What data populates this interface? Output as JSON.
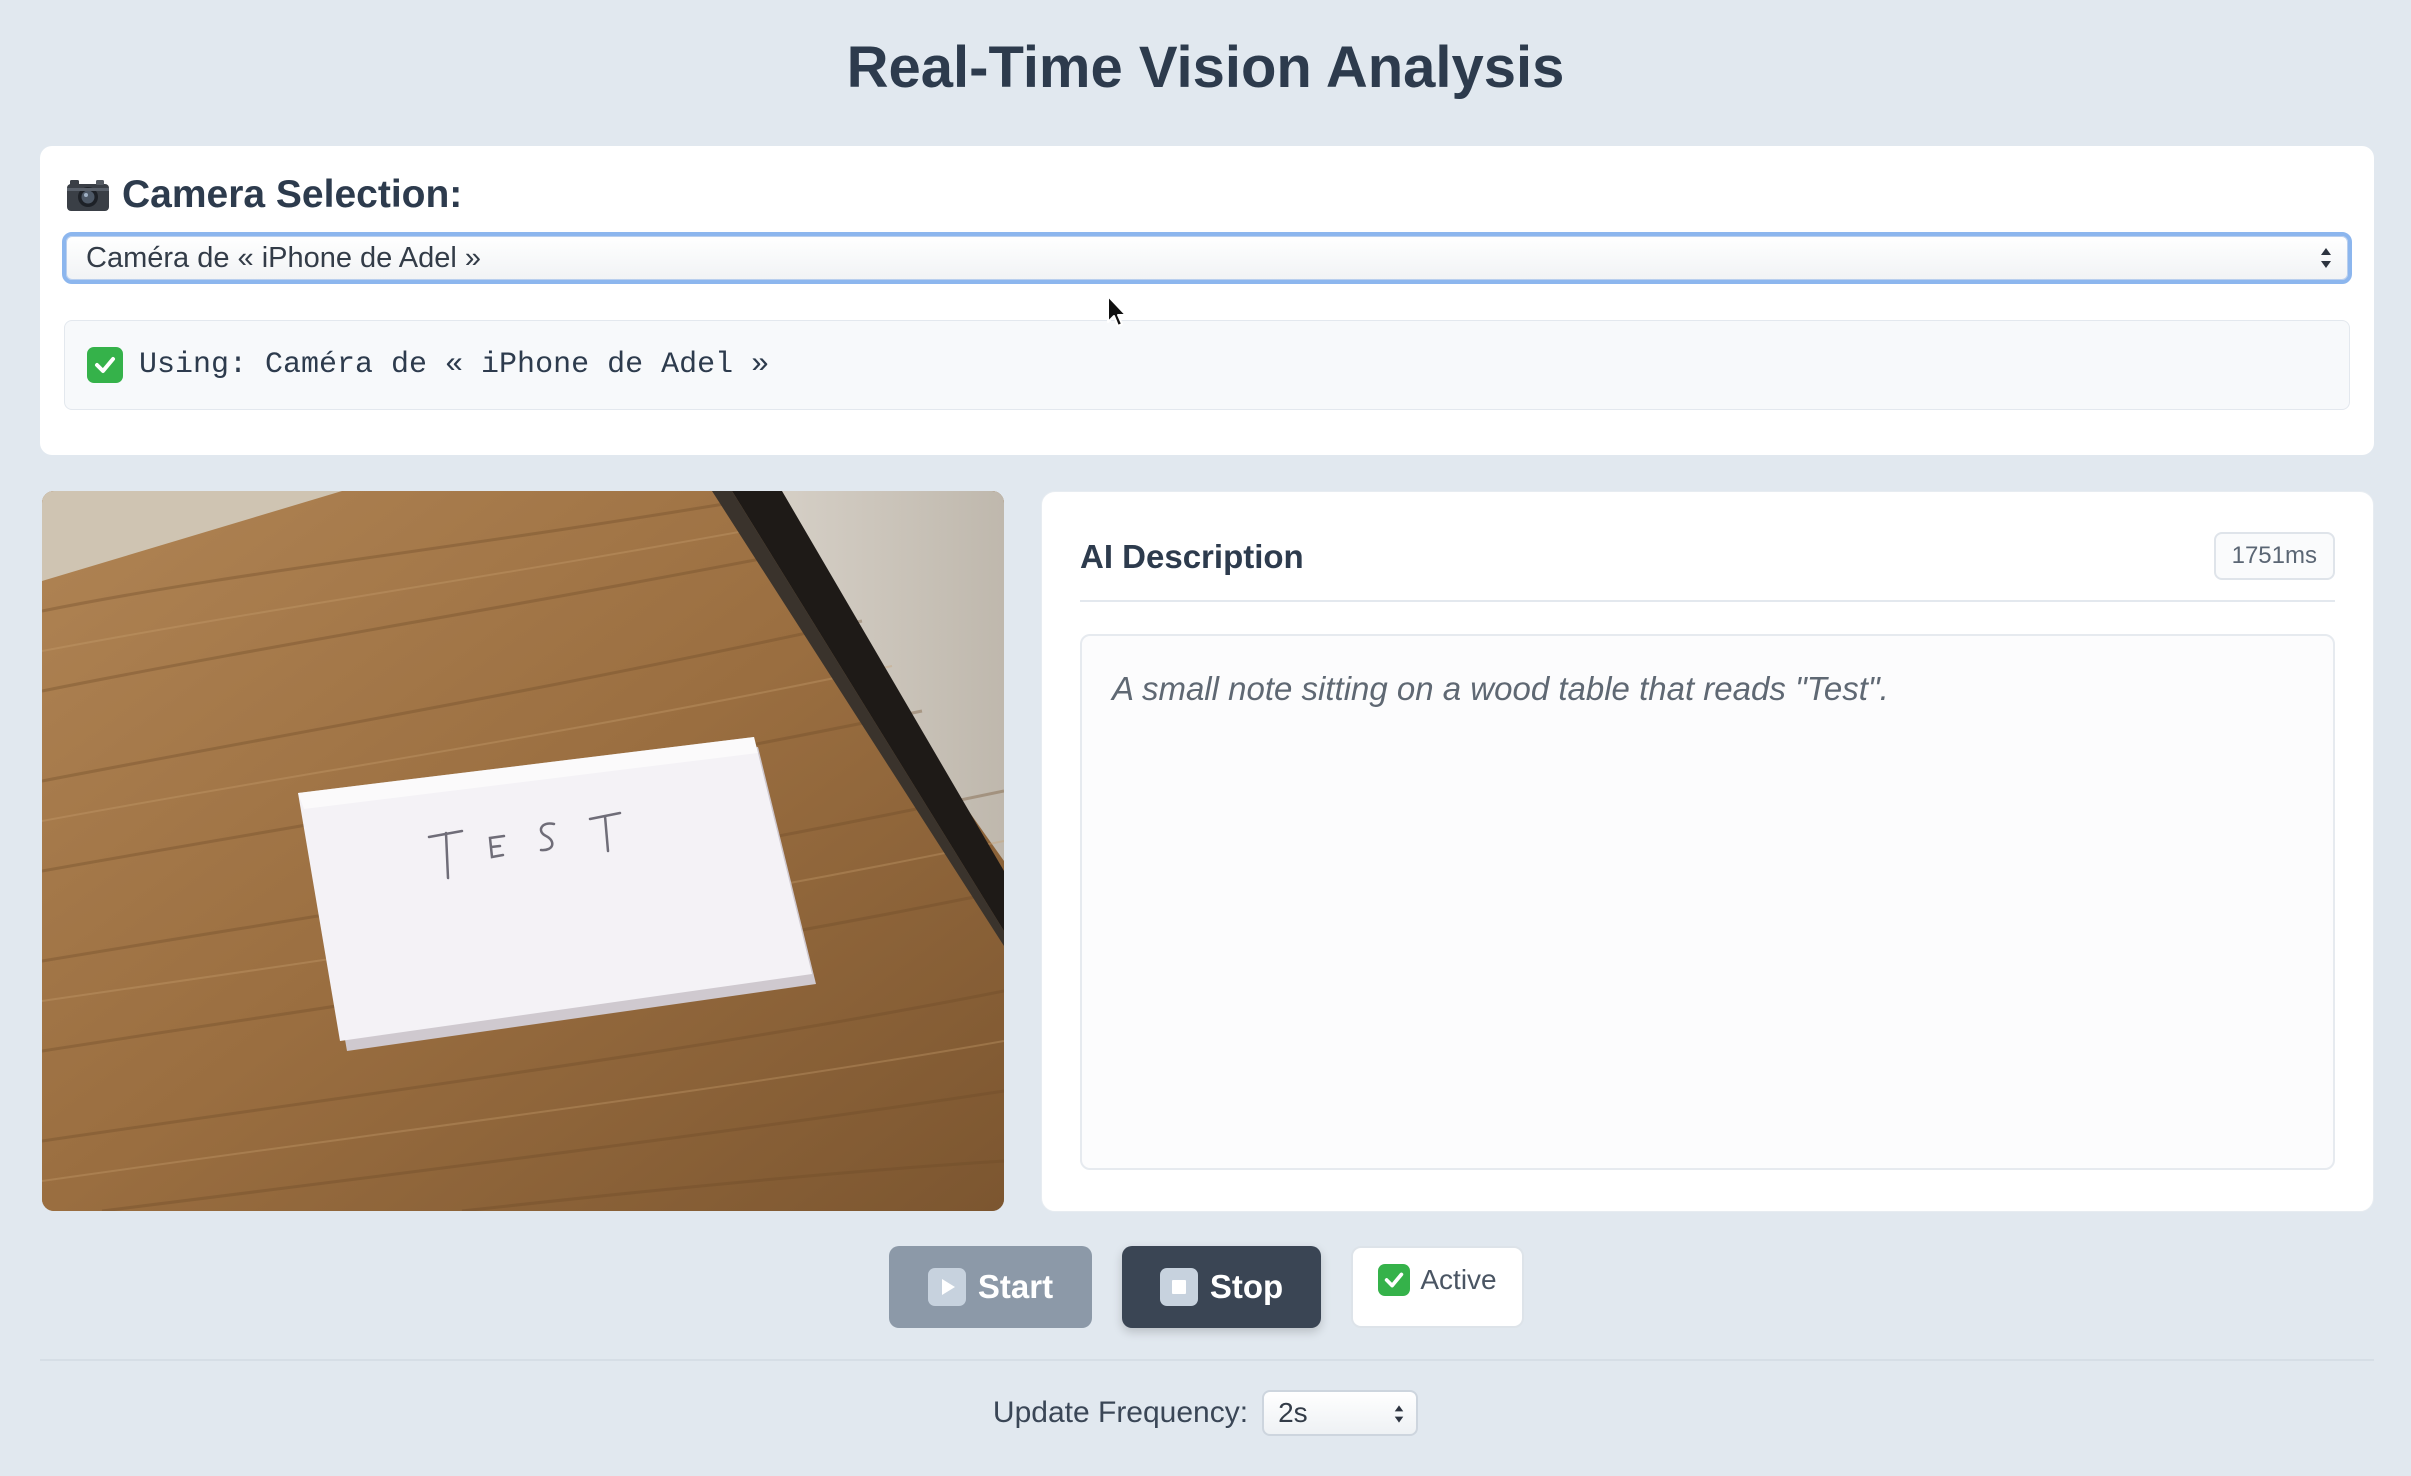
{
  "page": {
    "title": "Real-Time Vision Analysis"
  },
  "camera": {
    "heading_icon": "camera-icon",
    "heading": "Camera Selection:",
    "selected_option": "Caméra de « iPhone de Adel »",
    "status_icon": "check-icon",
    "status_text": "Using: Caméra de « iPhone de Adel »"
  },
  "video": {
    "note_text": "TEST"
  },
  "description": {
    "title": "AI Description",
    "latency": "1751ms",
    "text": "A small note sitting on a wood table that reads \"Test\"."
  },
  "controls": {
    "start_icon": "play-icon",
    "start_label": "Start",
    "stop_icon": "stop-icon",
    "stop_label": "Stop",
    "status_icon": "check-icon",
    "status_label": "Active"
  },
  "frequency": {
    "label": "Update Frequency:",
    "selected": "2s"
  },
  "colors": {
    "background": "#e1e8ef",
    "card": "#ffffff",
    "focus_ring": "#8cb6ee",
    "success": "#35b24a",
    "start_button": "#8c99a8",
    "stop_button": "#3a4554"
  }
}
